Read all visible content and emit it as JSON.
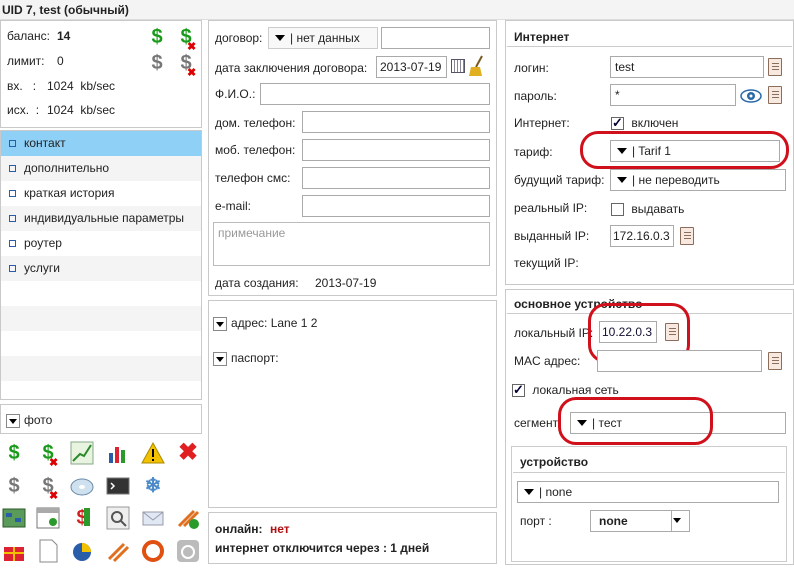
{
  "header": {
    "title": "UID 7, test (обычный)"
  },
  "left": {
    "stats": {
      "balance_label": "баланс:",
      "balance_value": "14",
      "limit_label": "лимит:",
      "limit_value": "0",
      "in_label": "вх.   :",
      "in_value": "1024  kb/sec",
      "out_label": "исх.  :",
      "out_value": "1024  kb/sec"
    },
    "nav": [
      "контакт",
      "дополнительно",
      "краткая история",
      "индивидуальные параметры",
      "роутер",
      "услуги"
    ],
    "photo_label": "фото"
  },
  "middle": {
    "contract_label": "договор:",
    "contract_select": "| нет данных",
    "contract_date_label": "дата заключения договора:",
    "contract_date_value": "2013-07-19",
    "fio_label": "Ф.И.О.:",
    "home_phone_label": "дом. телефон:",
    "mobile_phone_label": "моб. телефон:",
    "sms_phone_label": "телефон смс:",
    "email_label": "e-mail:",
    "note_placeholder": "примечание",
    "created_label": "дата создания:",
    "created_value": "2013-07-19",
    "address_label": "адрес: Lane 1 2",
    "passport_label": "паспорт:",
    "online_label": "онлайн:",
    "online_value": "нет",
    "disconnect_label": "интернет отключится через : 1 дней"
  },
  "right": {
    "internet_title": "Интернет",
    "login_label": "логин:",
    "login_value": "test",
    "password_label": "пароль:",
    "password_value": "*",
    "internet_label": "Интернет:",
    "internet_check_label": "включен",
    "tariff_label": "тариф:",
    "tariff_value": "| Tarif 1",
    "future_tariff_label": "будущий тариф:",
    "future_tariff_value": "| не переводить",
    "real_ip_label": "реальный IP:",
    "real_ip_check_label": "выдавать",
    "issued_ip_label": "выданный IP:",
    "issued_ip_value": "172.16.0.3",
    "current_ip_label": "текущий IP:",
    "device_title": "основное устройство",
    "local_ip_label": "локальный IP:",
    "local_ip_value": "10.22.0.3",
    "mac_label": "MAC адрес:",
    "local_net_label": "локальная сеть",
    "segment_label": "сегмент:",
    "segment_value": "| тест",
    "sub_device_title": "устройство",
    "sub_device_value": "| none",
    "port_label": "порт :",
    "port_value": "none"
  }
}
